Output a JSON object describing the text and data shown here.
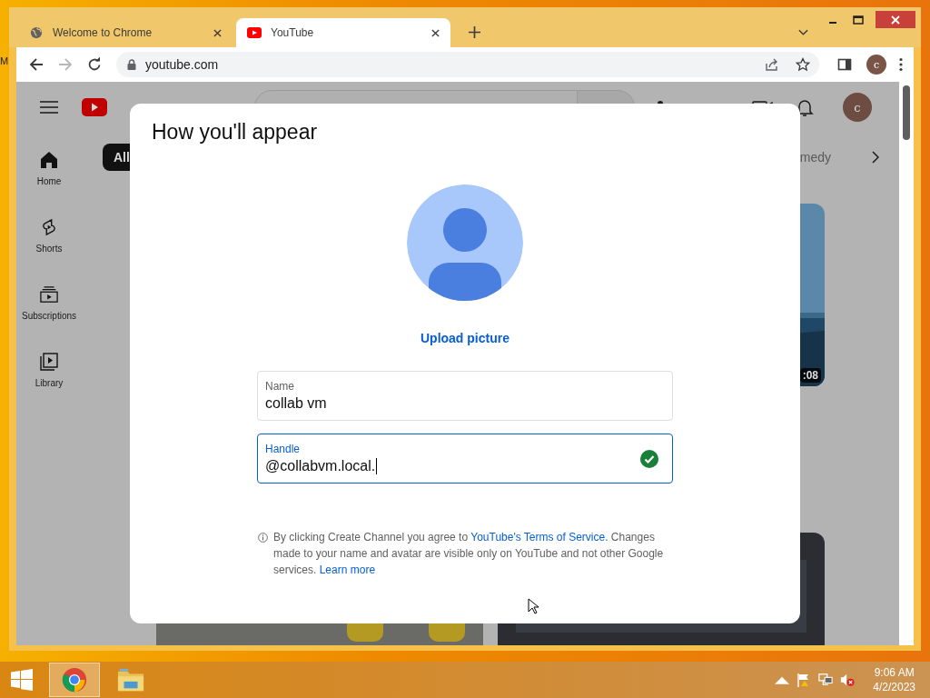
{
  "desktop": {
    "icon_label": "M"
  },
  "browser": {
    "tabs": [
      {
        "title": "Welcome to Chrome",
        "kind": "globe",
        "selected": false
      },
      {
        "title": "YouTube",
        "kind": "youtube",
        "selected": true
      }
    ],
    "address": "youtube.com",
    "forward_disabled": true,
    "profile_initial": "c"
  },
  "youtube": {
    "avatar_initial": "c",
    "sidebar": [
      {
        "label": "Home",
        "kind": "home"
      },
      {
        "label": "Shorts",
        "kind": "shorts"
      },
      {
        "label": "Subscriptions",
        "kind": "subscriptions"
      },
      {
        "label": "Library",
        "kind": "library"
      }
    ],
    "chips": [
      {
        "label": "All",
        "selected": true
      },
      {
        "label": "medy",
        "selected": false
      }
    ],
    "videos": [
      {
        "kind": "picture",
        "duration": ":08"
      },
      {
        "kind": "picture"
      },
      {
        "kind": "picture"
      }
    ]
  },
  "dialog": {
    "title": "How you'll appear",
    "upload_label": "Upload picture",
    "fields": [
      {
        "label": "Name",
        "value": "collab vm",
        "focused": false,
        "valid": false
      },
      {
        "label": "Handle",
        "value": "@collabvm.local.",
        "focused": true,
        "valid": true
      }
    ],
    "notice": [
      {
        "text": "By clicking Create Channel you agree to ",
        "link": false
      },
      {
        "text": "YouTube's Terms of Service.",
        "link": true
      },
      {
        "text": " Changes made to your name and avatar are visible only on YouTube and not other Google services. ",
        "link": false
      },
      {
        "text": "Learn more",
        "link": true
      }
    ]
  },
  "taskbar": {
    "apps": [
      {
        "kind": "chrome",
        "selected": true
      },
      {
        "kind": "explorer",
        "selected": false
      }
    ],
    "muted": true,
    "time": "9:06 AM",
    "date": "4/2/2023"
  }
}
